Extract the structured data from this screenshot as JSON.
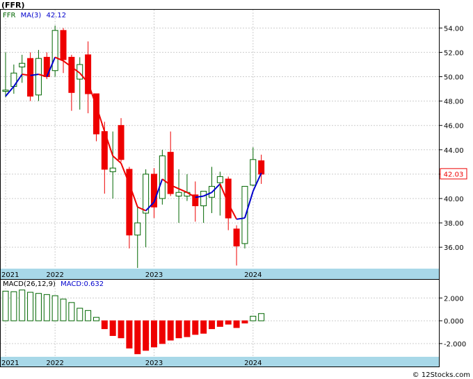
{
  "header": {
    "title": "(FFR)"
  },
  "footer": {
    "credit": "© 12Stocks.com"
  },
  "chart_data": [
    {
      "type": "candlestick",
      "interval": "monthly",
      "symbol": "FFR",
      "indicator": {
        "name": "MA(3)",
        "label": "FFR",
        "ma_label": "MA(3)",
        "ma_value": 42.12
      },
      "last_price": 42.03,
      "last_price_label": "42.03",
      "y_axis": {
        "ylim": [
          34.3,
          55.5
        ],
        "ticks": [
          36.0,
          38.0,
          40.0,
          42.0,
          44.0,
          46.0,
          48.0,
          50.0,
          52.0,
          54.0
        ],
        "tick_labels": [
          "36.00",
          "38.00",
          "40.00",
          "42.00",
          "44.00",
          "46.00",
          "48.00",
          "50.00",
          "52.00",
          "54.00"
        ]
      },
      "x_axis": {
        "year_labels": [
          {
            "label": "2021",
            "index": 0
          },
          {
            "label": "2022",
            "index": 6
          },
          {
            "label": "2023",
            "index": 18
          },
          {
            "label": "2024",
            "index": 30
          }
        ]
      },
      "candles": [
        {
          "date": "2020-12",
          "open": 48.8,
          "high": 52.0,
          "low": 48.3,
          "close": 48.9
        },
        {
          "date": "2021-01",
          "open": 49.2,
          "high": 51.0,
          "low": 48.6,
          "close": 50.3
        },
        {
          "date": "2021-02",
          "open": 50.8,
          "high": 51.8,
          "low": 49.5,
          "close": 51.1
        },
        {
          "date": "2021-03",
          "open": 51.5,
          "high": 52.0,
          "low": 48.0,
          "close": 48.4
        },
        {
          "date": "2021-04",
          "open": 48.5,
          "high": 52.2,
          "low": 48.0,
          "close": 51.5
        },
        {
          "date": "2021-05",
          "open": 51.6,
          "high": 52.0,
          "low": 49.8,
          "close": 50.0
        },
        {
          "date": "2021-06",
          "open": 50.5,
          "high": 54.2,
          "low": 50.0,
          "close": 53.8
        },
        {
          "date": "2021-07",
          "open": 53.8,
          "high": 54.0,
          "low": 50.3,
          "close": 51.4
        },
        {
          "date": "2021-08",
          "open": 51.6,
          "high": 51.8,
          "low": 47.2,
          "close": 48.7
        },
        {
          "date": "2021-09",
          "open": 49.8,
          "high": 51.6,
          "low": 47.3,
          "close": 51.0
        },
        {
          "date": "2021-10",
          "open": 51.8,
          "high": 52.9,
          "low": 47.0,
          "close": 48.6
        },
        {
          "date": "2021-11",
          "open": 48.6,
          "high": 48.6,
          "low": 44.7,
          "close": 45.3
        },
        {
          "date": "2021-12",
          "open": 45.5,
          "high": 46.3,
          "low": 40.4,
          "close": 42.4
        },
        {
          "date": "2022-01",
          "open": 42.2,
          "high": 45.5,
          "low": 40.0,
          "close": 42.5
        },
        {
          "date": "2022-02",
          "open": 46.0,
          "high": 46.6,
          "low": 43.0,
          "close": 43.2
        },
        {
          "date": "2022-03",
          "open": 42.4,
          "high": 42.6,
          "low": 35.9,
          "close": 37.0
        },
        {
          "date": "2022-04",
          "open": 37.0,
          "high": 39.4,
          "low": 34.3,
          "close": 38.0
        },
        {
          "date": "2022-05",
          "open": 38.8,
          "high": 42.4,
          "low": 36.0,
          "close": 42.0
        },
        {
          "date": "2022-06",
          "open": 42.0,
          "high": 42.5,
          "low": 38.4,
          "close": 39.3
        },
        {
          "date": "2022-07",
          "open": 40.0,
          "high": 44.0,
          "low": 39.5,
          "close": 43.5
        },
        {
          "date": "2022-08",
          "open": 43.8,
          "high": 45.5,
          "low": 40.2,
          "close": 40.4
        },
        {
          "date": "2022-09",
          "open": 40.2,
          "high": 42.4,
          "low": 38.0,
          "close": 40.5
        },
        {
          "date": "2022-10",
          "open": 40.2,
          "high": 42.0,
          "low": 39.8,
          "close": 40.5
        },
        {
          "date": "2022-11",
          "open": 40.3,
          "high": 41.4,
          "low": 38.1,
          "close": 39.4
        },
        {
          "date": "2022-12",
          "open": 39.4,
          "high": 40.4,
          "low": 38.0,
          "close": 40.6
        },
        {
          "date": "2023-01",
          "open": 40.1,
          "high": 42.6,
          "low": 38.8,
          "close": 41.0
        },
        {
          "date": "2023-02",
          "open": 41.3,
          "high": 42.2,
          "low": 38.6,
          "close": 41.8
        },
        {
          "date": "2023-03",
          "open": 41.6,
          "high": 41.8,
          "low": 37.4,
          "close": 38.4
        },
        {
          "date": "2023-04",
          "open": 37.5,
          "high": 37.8,
          "low": 34.5,
          "close": 36.1
        },
        {
          "date": "2023-05",
          "open": 36.3,
          "high": 41.0,
          "low": 35.9,
          "close": 41.0
        },
        {
          "date": "2023-06",
          "open": 41.1,
          "high": 44.2,
          "low": 41.0,
          "close": 43.2
        },
        {
          "date": "2023-07",
          "open": 43.1,
          "high": 43.6,
          "low": 41.2,
          "close": 42.0
        }
      ],
      "ma_line": [
        {
          "index": 0,
          "value": 48.4
        },
        {
          "index": 1,
          "value": 49.2
        },
        {
          "index": 2,
          "value": 50.2
        },
        {
          "index": 3,
          "value": 50.1
        },
        {
          "index": 4,
          "value": 50.2
        },
        {
          "index": 5,
          "value": 50.0
        },
        {
          "index": 6,
          "value": 51.6
        },
        {
          "index": 7,
          "value": 51.3
        },
        {
          "index": 8,
          "value": 50.8
        },
        {
          "index": 9,
          "value": 50.3
        },
        {
          "index": 10,
          "value": 49.5
        },
        {
          "index": 11,
          "value": 47.6
        },
        {
          "index": 12,
          "value": 45.5
        },
        {
          "index": 13,
          "value": 43.5
        },
        {
          "index": 14,
          "value": 42.9
        },
        {
          "index": 15,
          "value": 41.2
        },
        {
          "index": 16,
          "value": 39.3
        },
        {
          "index": 17,
          "value": 39.0
        },
        {
          "index": 18,
          "value": 39.7
        },
        {
          "index": 19,
          "value": 41.6
        },
        {
          "index": 20,
          "value": 41.1
        },
        {
          "index": 21,
          "value": 40.8
        },
        {
          "index": 22,
          "value": 40.5
        },
        {
          "index": 23,
          "value": 40.1
        },
        {
          "index": 24,
          "value": 40.2
        },
        {
          "index": 25,
          "value": 40.5
        },
        {
          "index": 26,
          "value": 41.2
        },
        {
          "index": 27,
          "value": 39.6
        },
        {
          "index": 28,
          "value": 38.3
        },
        {
          "index": 29,
          "value": 38.4
        },
        {
          "index": 30,
          "value": 40.6
        },
        {
          "index": 31,
          "value": 42.1
        }
      ],
      "ma_colors": {
        "up": "#0000cc",
        "down": "#ee0000"
      }
    },
    {
      "type": "bar",
      "indicator": {
        "name": "MACD(26,12,9)",
        "label": "MACD(26,12,9)",
        "value_label": "MACD:0.632",
        "value": 0.632
      },
      "y_axis": {
        "ylim": [
          -3.1,
          3.6
        ],
        "ticks": [
          -2.0,
          0.0,
          2.0
        ],
        "tick_labels": [
          "-2.000",
          "0.000",
          "2.000"
        ]
      },
      "x_axis": {
        "year_labels": [
          {
            "label": "2021",
            "index": 0
          },
          {
            "label": "2022",
            "index": 6
          },
          {
            "label": "2023",
            "index": 18
          },
          {
            "label": "2024",
            "index": 30
          }
        ]
      },
      "values": [
        2.6,
        2.55,
        2.7,
        2.5,
        2.4,
        2.3,
        2.2,
        1.9,
        1.6,
        1.1,
        0.9,
        0.3,
        -0.7,
        -1.3,
        -1.5,
        -2.4,
        -2.9,
        -2.6,
        -2.3,
        -2.0,
        -1.7,
        -1.5,
        -1.4,
        -1.2,
        -1.1,
        -0.7,
        -0.5,
        -0.3,
        -0.6,
        -0.2,
        0.4,
        0.632
      ],
      "colors": {
        "up": "#006600",
        "down": "#ee0000"
      }
    }
  ],
  "colors": {
    "axis_band": "#a8d8e8",
    "up_candle": "#006600",
    "down_candle": "#ee0000",
    "last_price_box": "#ee0000",
    "grid": "#cccccc"
  }
}
